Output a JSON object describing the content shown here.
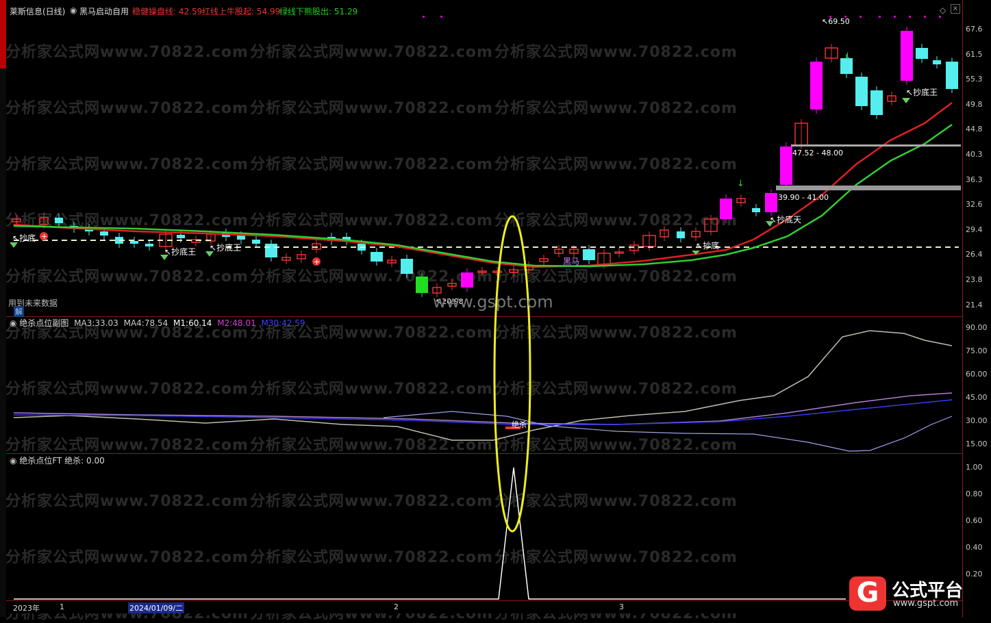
{
  "header": {
    "stock": "莱斯信息(日线)",
    "indicator": "黑马启动自用",
    "params": [
      {
        "label": "稳健操盘线:",
        "value": "42.59",
        "color": "#e33"
      },
      {
        "label": "红线上牛股起:",
        "value": "54.99",
        "color": "#e33"
      },
      {
        "label": "绿线下熊股出:",
        "value": "51.29",
        "color": "#2c2"
      }
    ]
  },
  "main_axis": [
    "67.6",
    "61.5",
    "55.3",
    "49.8",
    "44.8",
    "40.3",
    "36.3",
    "32.6",
    "29.4",
    "26.4",
    "23.8",
    "21.4"
  ],
  "sub_header": {
    "name": "绝杀点位副图",
    "items": [
      {
        "label": "MA3:",
        "value": "33.03",
        "color": "#ccc"
      },
      {
        "label": "MA4:",
        "value": "78.54",
        "color": "#ccc"
      },
      {
        "label": "M1:",
        "value": "60.14",
        "color": "#fff"
      },
      {
        "label": "M2:",
        "value": "48.01",
        "color": "#d040d0"
      },
      {
        "label": "M30:",
        "value": "42.59",
        "color": "#4040ff"
      }
    ]
  },
  "sub_axis": [
    "90.00",
    "75.00",
    "60.00",
    "45.00",
    "30.00",
    "15.00"
  ],
  "ft_header": {
    "name": "绝杀点位FT",
    "label": "绝杀:",
    "value": "0.00"
  },
  "ft_axis": [
    "1.00",
    "0.80",
    "0.60",
    "0.40",
    "0.20"
  ],
  "labels": {
    "future": "用到未来数据",
    "jie": "解",
    "high": "69.50",
    "low": "20.98",
    "box1": "47.52 - 48.00",
    "box2": "39.90 - 41.00",
    "chaodi": "抄底",
    "chaodiwang1": "抄底王",
    "chaodiwang2": "抄底王",
    "chaodiwang3": "抄底王",
    "chaodi2": "抄底天",
    "heima": "黑马",
    "juesha": "绝杀",
    "site": "www.gspt.com"
  },
  "dates": {
    "year": "2023年",
    "m1": "1",
    "selected": "2024/01/09/二",
    "m2": "2",
    "m3": "3"
  },
  "watermark": "分析家公式网www.70822.com",
  "logo": {
    "text": "公式平台",
    "url": "www.gspt.com"
  },
  "colors": {
    "up": "#e33",
    "down": "#5ee",
    "magenta": "#f0f",
    "green": "#2c2",
    "yellow": "#ee2"
  }
}
